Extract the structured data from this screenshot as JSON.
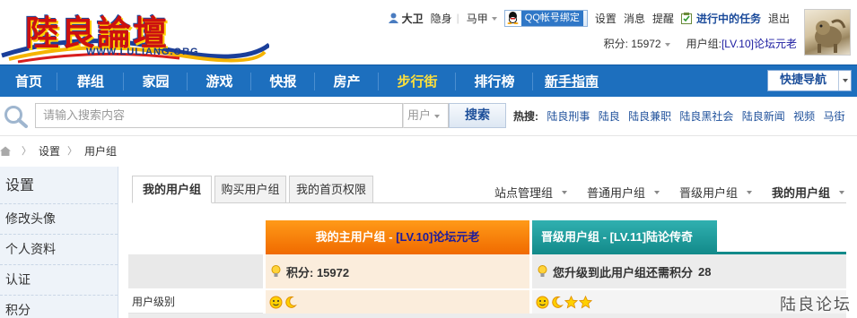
{
  "logo": {
    "title": "陸良論壇",
    "url": "WWW.LULIANG.ORG"
  },
  "userbar": {
    "username": "大卫",
    "stealth": "隐身",
    "vest": "马甲",
    "qq_bind": "QQ帐号绑定",
    "settings": "设置",
    "messages": "消息",
    "reminders": "提醒",
    "tasks": "进行中的任务",
    "logout": "退出"
  },
  "scorebar": {
    "score_label": "积分: 15972",
    "usergroup_label": "用户组: ",
    "usergroup_value": "[LV.10]论坛元老"
  },
  "nav": {
    "items": [
      "首页",
      "群组",
      "家园",
      "游戏",
      "快报",
      "房产",
      "步行街",
      "排行榜",
      "新手指南"
    ],
    "quick_nav": "快捷导航"
  },
  "search": {
    "placeholder": "请输入搜索内容",
    "type": "用户",
    "button": "搜索",
    "hot_label": "热搜:",
    "hot_items": [
      "陆良刑事",
      "陆良",
      "陆良兼职",
      "陆良黑社会",
      "陆良新闻",
      "视频",
      "马街"
    ]
  },
  "breadcrumb": {
    "items": [
      "设置",
      "用户组"
    ]
  },
  "sidebar": {
    "title": "设置",
    "items": [
      "修改头像",
      "个人资料",
      "认证",
      "积分"
    ]
  },
  "tabs": [
    "我的用户组",
    "购买用户组",
    "我的首页权限"
  ],
  "filters": [
    "站点管理组",
    "普通用户组",
    "晋级用户组",
    "我的用户组"
  ],
  "group_table": {
    "col1_title": "我的主用户组",
    "col1_level": "[LV.10]论坛元老",
    "col2_title": "晋级用户组",
    "col2_level": "[LV.11]陆论传奇",
    "row1_col1": "积分: 15972",
    "row1_col2": "您升级到此用户组还需积分",
    "row1_col2_value": "28",
    "row2_label": "用户级别"
  },
  "watermark": "陆良论坛",
  "colors": {
    "nav_bg": "#1d6fbe",
    "nav_highlight": "#ffe03a",
    "orange_header": "#f07a00",
    "teal_header": "#1a9a9a",
    "link_blue": "#1d4f9a"
  }
}
